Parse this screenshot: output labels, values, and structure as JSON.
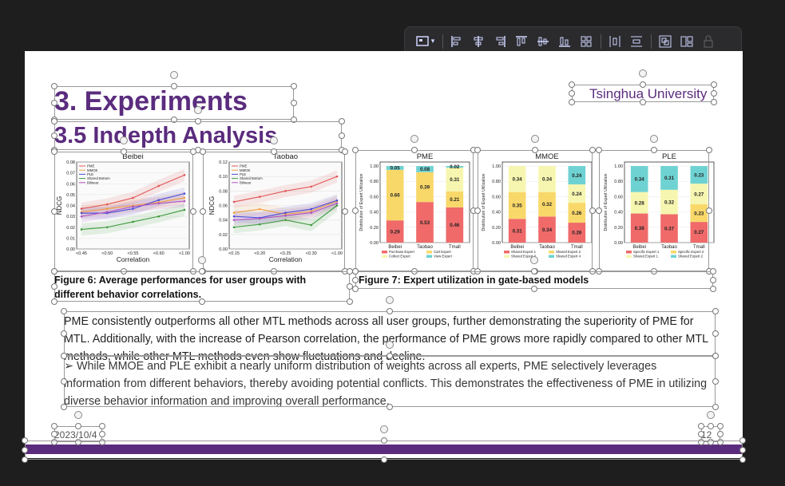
{
  "toolbar": {
    "tools": [
      "layout-icon",
      "align-left-icon",
      "align-center-icon",
      "align-right-icon",
      "align-top-icon",
      "align-middle-icon",
      "align-bottom-icon",
      "distribute-icon",
      "distribute-horizontal-icon",
      "distribute-vertical-icon",
      "group-icon",
      "ungroup-icon",
      "lock-icon"
    ]
  },
  "slide": {
    "title": "3. Experiments",
    "subtitle": "3.5 Indepth Analysis",
    "university": "Tsinghua University",
    "fig6_caption": "Figure 6: Average performances for user groups with different behavior correlations.",
    "fig7_caption": "Figure 7: Expert utilization in gate-based models",
    "para1": "PME consistently outperforms all other MTL methods across all user groups, further demonstrating the superiority of PME for MTL. Additionally, with the increase of Pearson correlation, the performance of PME grows more rapidly compared to other MTL methods, while other MTL methods even show fluctuations and decline.",
    "para2": "➢ While MMOE and PLE exhibit a nearly uniform distribution of weights across all experts, PME selectively leverages information from different behaviors, thereby avoiding potential conflicts. This demonstrates the effectiveness of PME in utilizing diverse behavior information and improving overall performance.",
    "date": "2023/10/4",
    "page": "12",
    "accent": "#5b2c7e"
  },
  "chart_data": [
    {
      "type": "line",
      "title": "Beibei",
      "xlabel": "Correlation",
      "ylabel": "NDCG",
      "categories": [
        "<0.45",
        "<0.50",
        "<0.55",
        "<0.60",
        "<1.00"
      ],
      "ylim": [
        0,
        0.08
      ],
      "yticks": [
        "0.00",
        "0.01",
        "0.02",
        "0.03",
        "0.04",
        "0.05",
        "0.06",
        "0.07",
        "0.08"
      ],
      "legend": "top-left",
      "series": [
        {
          "name": "PME",
          "color": "#e05555",
          "values": [
            0.037,
            0.041,
            0.047,
            0.058,
            0.068
          ]
        },
        {
          "name": "MMOE",
          "color": "#f0a040",
          "values": [
            0.034,
            0.037,
            0.04,
            0.043,
            0.047
          ]
        },
        {
          "name": "PLE",
          "color": "#4a4ad8",
          "values": [
            0.033,
            0.033,
            0.037,
            0.045,
            0.051
          ]
        },
        {
          "name": "Shared Bottom",
          "color": "#3a9a3a",
          "values": [
            0.018,
            0.02,
            0.025,
            0.03,
            0.036
          ]
        },
        {
          "name": "Bilinear",
          "color": "#b050c0",
          "values": [
            0.03,
            0.034,
            0.039,
            0.042,
            0.044
          ]
        }
      ]
    },
    {
      "type": "line",
      "title": "Taobao",
      "xlabel": "Correlation",
      "ylabel": "NDCG",
      "categories": [
        "<0.15",
        "<0.20",
        "<0.25",
        "<0.30",
        "<1.00"
      ],
      "ylim": [
        0,
        0.12
      ],
      "yticks": [
        "0.00",
        "0.02",
        "0.04",
        "0.06",
        "0.08",
        "0.10",
        "0.12"
      ],
      "legend": "top-left",
      "series": [
        {
          "name": "PME",
          "color": "#e05555",
          "values": [
            0.065,
            0.072,
            0.08,
            0.086,
            0.1
          ]
        },
        {
          "name": "MMOE",
          "color": "#f0a040",
          "values": [
            0.05,
            0.055,
            0.048,
            0.052,
            0.066
          ]
        },
        {
          "name": "PLE",
          "color": "#4a4ad8",
          "values": [
            0.045,
            0.043,
            0.05,
            0.055,
            0.067
          ]
        },
        {
          "name": "Shared Bottom",
          "color": "#3a9a3a",
          "values": [
            0.03,
            0.034,
            0.04,
            0.033,
            0.06
          ]
        },
        {
          "name": "Bilinear",
          "color": "#b050c0",
          "values": [
            0.04,
            0.042,
            0.046,
            0.05,
            0.063
          ]
        }
      ]
    },
    {
      "type": "bar",
      "title": "PME",
      "ylabel": "Distribution of Expert Utilization",
      "categories": [
        "Beibei",
        "Taobao",
        "Tmall"
      ],
      "ylim": [
        0,
        1
      ],
      "yticks": [
        "0.00",
        "0.20",
        "0.40",
        "0.60",
        "0.80",
        "1.00"
      ],
      "series": [
        {
          "name": "Purchase Expert",
          "color": "#f06a6a",
          "values": [
            0.29,
            0.53,
            0.46
          ]
        },
        {
          "name": "Cart Expert",
          "color": "#f9d86a",
          "values": [
            0.66,
            0.39,
            0.21
          ]
        },
        {
          "name": "Collect Expert",
          "color": "#f6f6b0",
          "values": [
            0.0,
            0.0,
            0.31
          ]
        },
        {
          "name": "View Expert",
          "color": "#6fd2d2",
          "values": [
            0.05,
            0.08,
            0.02
          ]
        }
      ],
      "labels": [
        [
          "0.29",
          "0.66",
          "",
          "0.05"
        ],
        [
          "0.53",
          "0.39",
          "",
          "0.08"
        ],
        [
          "0.46",
          "0.21",
          "0.31",
          "0.02"
        ]
      ]
    },
    {
      "type": "bar",
      "title": "MMOE",
      "ylabel": "Distribution of Expert Utilization",
      "categories": [
        "Beibei",
        "Taobao",
        "Tmall"
      ],
      "ylim": [
        0,
        1
      ],
      "yticks": [
        "0.00",
        "0.20",
        "0.40",
        "0.60",
        "0.80",
        "1.00"
      ],
      "series": [
        {
          "name": "Shared Expert 1",
          "color": "#f06a6a",
          "values": [
            0.31,
            0.34,
            0.26
          ]
        },
        {
          "name": "Shared Expert 2",
          "color": "#f9d86a",
          "values": [
            0.35,
            0.32,
            0.26
          ]
        },
        {
          "name": "Shared Expert 3",
          "color": "#f6f6b0",
          "values": [
            0.34,
            0.34,
            0.24
          ]
        },
        {
          "name": "Shared Expert 4",
          "color": "#6fd2d2",
          "values": [
            0.0,
            0.0,
            0.24
          ]
        }
      ],
      "labels": [
        [
          "0.31",
          "0.35",
          "0.34",
          ""
        ],
        [
          "0.34",
          "0.32",
          "0.34",
          ""
        ],
        [
          "0.26",
          "0.26",
          "0.24",
          "0.24"
        ]
      ]
    },
    {
      "type": "bar",
      "title": "PLE",
      "ylabel": "Distribution of Expert Utilization",
      "categories": [
        "Beibei",
        "Taobao",
        "Tmall"
      ],
      "ylim": [
        0,
        1
      ],
      "yticks": [
        "0.00",
        "0.20",
        "0.40",
        "0.60",
        "0.80",
        "1.00"
      ],
      "series": [
        {
          "name": "Specific Expert 1",
          "color": "#f06a6a",
          "values": [
            0.38,
            0.37,
            0.27
          ]
        },
        {
          "name": "Specific Expert 2",
          "color": "#f9d86a",
          "values": [
            0.0,
            0.0,
            0.23
          ]
        },
        {
          "name": "Shared Expert 1",
          "color": "#f6f6b0",
          "values": [
            0.28,
            0.32,
            0.27
          ]
        },
        {
          "name": "Shared Expert 2",
          "color": "#6fd2d2",
          "values": [
            0.34,
            0.31,
            0.23
          ]
        }
      ],
      "labels": [
        [
          "0.38",
          "",
          "0.28",
          "0.34"
        ],
        [
          "0.37",
          "",
          "0.32",
          "0.31"
        ],
        [
          "0.27",
          "0.23",
          "0.27",
          "0.23"
        ]
      ]
    }
  ]
}
